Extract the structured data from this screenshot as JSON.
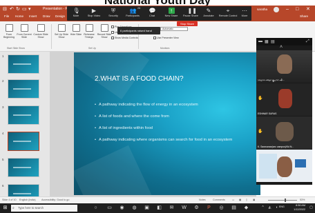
{
  "banner": {
    "text": "National Youth Day"
  },
  "titlebar": {
    "app_title": "Presentation - PowerPoint",
    "user": "saratha"
  },
  "tabs": [
    "File",
    "Home",
    "Insert",
    "Draw",
    "Design",
    "Transitions",
    "Animations",
    "Slide Show",
    "Review",
    "View",
    "Help"
  ],
  "active_tab": "Slide Show",
  "share": "Share",
  "ribbon": {
    "buttons": [
      "From Beginning",
      "From Current Slide",
      "Custom Slide Show",
      "Set Up Slide Show",
      "Hide Slide",
      "Rehearse Timings",
      "Record Slide Show"
    ],
    "checkboxes": [
      "Play Narrations",
      "Use Timings",
      "Show Media Controls"
    ],
    "monitor_combo": "Automatic",
    "presenter_view": "Use Presenter View",
    "groups": [
      "Start Slide Show",
      "Set Up",
      "Monitors"
    ]
  },
  "zoom_bar": {
    "items": [
      {
        "label": "Mute",
        "icon": "microphone-icon"
      },
      {
        "label": "Stop Video",
        "icon": "video-camera-icon"
      },
      {
        "label": "Security",
        "icon": "shield-icon"
      },
      {
        "label": "Participants",
        "icon": "people-icon",
        "count": "26"
      },
      {
        "label": "Chat",
        "icon": "chat-icon"
      },
      {
        "label": "New Share",
        "icon": "share-screen-icon",
        "highlight": true
      },
      {
        "label": "Pause Share",
        "icon": "pause-icon"
      },
      {
        "label": "Annotate",
        "icon": "pen-icon"
      },
      {
        "label": "Remote Control",
        "icon": "mouse-icon"
      },
      {
        "label": "More",
        "icon": "more-icon"
      }
    ],
    "stop_share": "Stop Share",
    "popup": "6 participants raised hand"
  },
  "thumbnails": [
    {
      "num": "1",
      "selected": false
    },
    {
      "num": "2",
      "selected": false
    },
    {
      "num": "3",
      "selected": false
    },
    {
      "num": "4",
      "selected": true
    },
    {
      "num": "5",
      "selected": false
    },
    {
      "num": "6",
      "selected": false
    }
  ],
  "slide": {
    "title": "2.WHAT IS A FOOD CHAIN?",
    "bullets": [
      "A pathway indicating the flow of energy in an ecosystem",
      "A list of foods and where the come from",
      "A list of ingredients within food",
      "A pathway indicating where organisms can search for food in an ecosystem"
    ]
  },
  "participants": {
    "tiles": [
      {
        "name": "ராஜுக் சுகிதா குமார் ஷி...",
        "hand": false
      },
      {
        "name": "ESHWAR SURAS",
        "hand": true
      },
      {
        "name": "K. Saravanan(sec campus)/Kd N...",
        "hand": true
      },
      {
        "name": "",
        "hand": false
      }
    ]
  },
  "statusbar": {
    "slide_info": "Slide 4 of 10",
    "language": "English (India)",
    "accessibility": "Accessibility: Good to go",
    "notes": "Notes",
    "comments": "Comments",
    "zoom": "53%"
  },
  "taskbar": {
    "search_placeholder": "Type here to search",
    "time": "8:56 AM",
    "date": "1/12/2022",
    "lang": "ENG"
  }
}
